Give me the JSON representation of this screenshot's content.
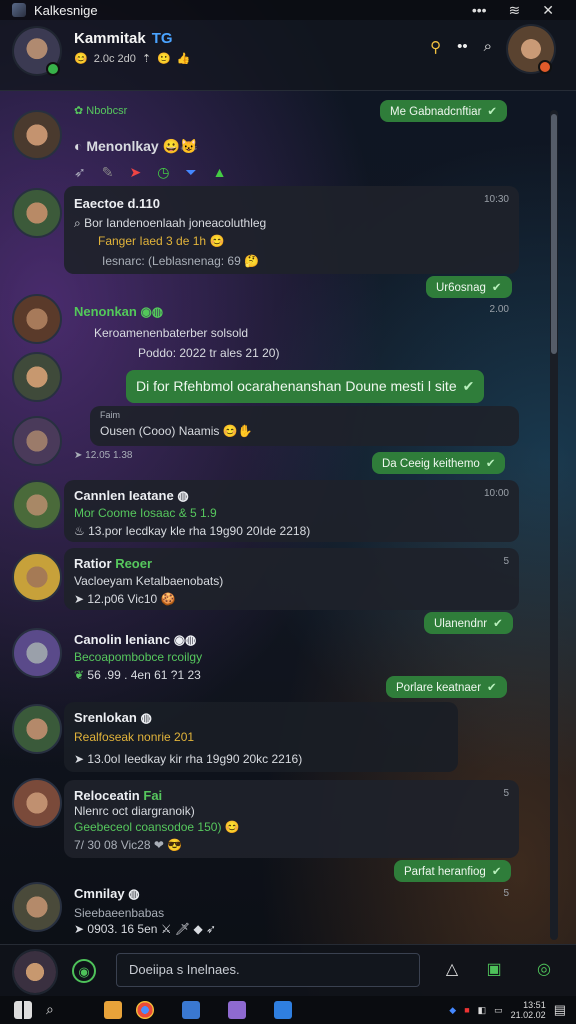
{
  "window": {
    "title": "Kalkesnige",
    "controls": [
      "•••",
      "wifi",
      "✕"
    ]
  },
  "header": {
    "name": "Kammitak",
    "tag": "TG",
    "sub": "2.0c 2d0",
    "icons": [
      "person-icon",
      "more-icon",
      "search-icon"
    ]
  },
  "messages": {
    "m1": {
      "label": "Nbobcsr",
      "title": "Menonlkay",
      "icons": [
        "rocket",
        "pen",
        "arrow",
        "clock",
        "filter",
        "tree"
      ]
    },
    "out1": "Me Gabnadcnftiar",
    "m2": {
      "sender": "Eaectoe d.110",
      "time": "10:30",
      "l1": "Bor Iandenoenlaah joneacoluthleg",
      "l2": "Fanger Iaed 3 de 1h",
      "l3": "Iesnarc: (Leblasnenag: 69"
    },
    "out2": "Ur6osnag",
    "m3": {
      "sender": "Nenonkan",
      "time": "2.00",
      "l1": "Keroamenenbaterber solsold",
      "l2": "Poddo: 2022 tr ales 21 20)"
    },
    "out3": "Di for Rfehbmol ocarahenanshan Doune mesti l site",
    "m4": {
      "l0": "Faim",
      "l1": "Ousen (Cooo) Naamis",
      "l2": "12.05 1.38"
    },
    "out4": "Da Ceeig keithemo",
    "m5": {
      "sender": "Cannlen Ieatane",
      "time": "10:00",
      "l1": "Mor Coome Iosaac & 5 1.9",
      "l2": "13.por  Iecdkay kle rha 19g90 20Ide 2218)"
    },
    "m6": {
      "sender": "Ratior",
      "tag": "Reoer",
      "time": "5",
      "l1": "Vacloeyam Ketalbaenobats)",
      "l2": "12.p06 Vic10"
    },
    "out5": "Ulanendnr",
    "out6": "Porlare keatnaer",
    "m7": {
      "sender": "Canolin Ienianc",
      "l1": "Becoapombobce rcoilgy",
      "l2": "56 .99 . 4en  61  ?1  23"
    },
    "m8": {
      "sender": "Srenlokan",
      "l1": "Realfoseak nonrie 201",
      "l2": "13.0oI   Ieedkay kir rha 19g90 20kc 2216)"
    },
    "m9": {
      "sender": "Reloceatin",
      "tag": "Fai",
      "time": "5",
      "l1": "Nlenrc oct diargranoik)",
      "l2": "Geebeceol coansodoe 150)",
      "l3": "7/ 30 08 Vic28"
    },
    "out7": "Parfat heranfiog",
    "m10": {
      "sender": "Cmnilay",
      "time": "5",
      "l1": "Sieebaeenbabas",
      "l2": "0903. 16 5en"
    }
  },
  "composer": {
    "placeholder": "Doeiipa s Inelnaes."
  },
  "taskbar": {
    "time": "13:51",
    "date": "21.02.02"
  },
  "colors": {
    "accent": "#2f7d3a",
    "online": "#38b24a",
    "link": "#4aa3ff"
  }
}
